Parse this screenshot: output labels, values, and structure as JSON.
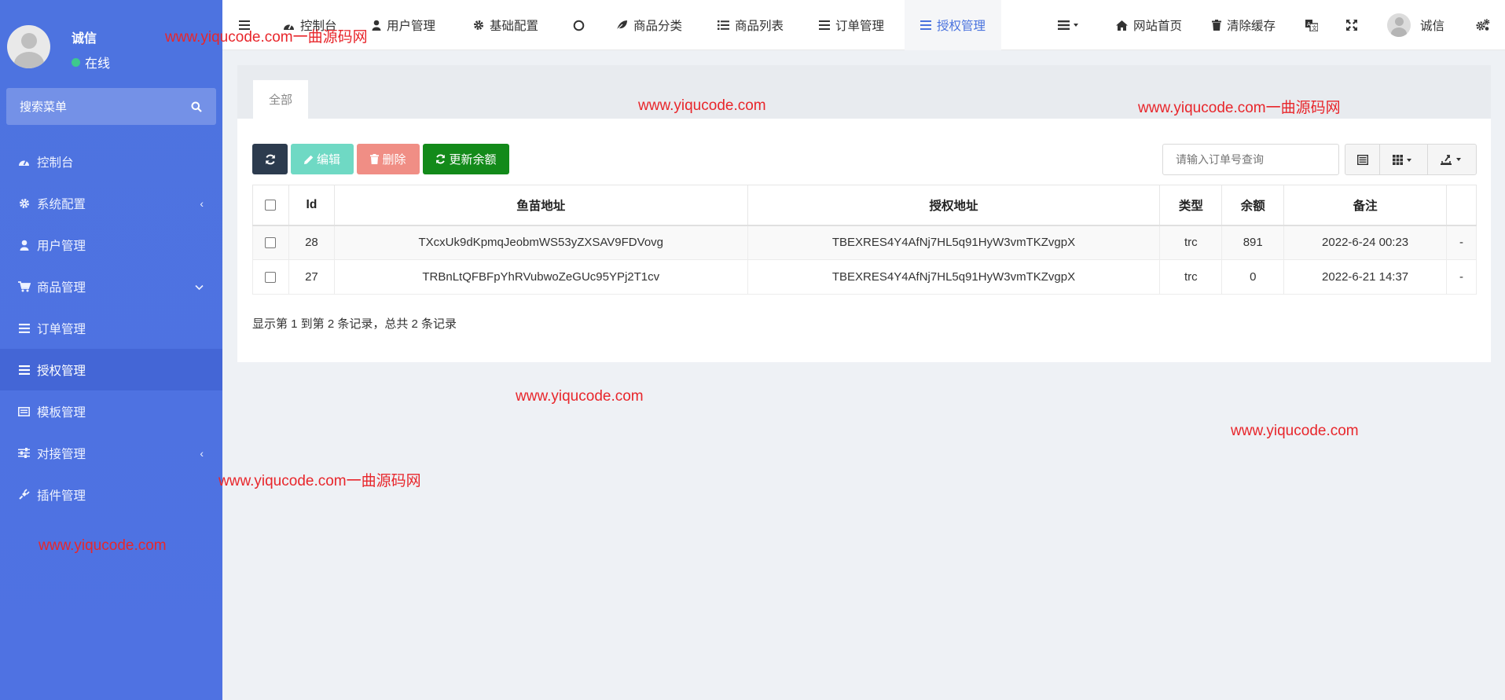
{
  "sidebar": {
    "user": {
      "name": "诚信",
      "status": "在线"
    },
    "search_label": "搜索菜单",
    "items": [
      {
        "label": "控制台",
        "icon": "dashboard-icon",
        "arrow": ""
      },
      {
        "label": "系统配置",
        "icon": "gear-icon",
        "arrow": "‹"
      },
      {
        "label": "用户管理",
        "icon": "user-icon",
        "arrow": ""
      },
      {
        "label": "商品管理",
        "icon": "cart-icon",
        "arrow": "⌄"
      },
      {
        "label": "订单管理",
        "icon": "list-icon",
        "arrow": ""
      },
      {
        "label": "授权管理",
        "icon": "list-icon",
        "arrow": "",
        "active": true
      },
      {
        "label": "模板管理",
        "icon": "template-icon",
        "arrow": ""
      },
      {
        "label": "对接管理",
        "icon": "sliders-icon",
        "arrow": "‹"
      },
      {
        "label": "插件管理",
        "icon": "plug-icon",
        "arrow": ""
      }
    ]
  },
  "topbar": {
    "nav": [
      {
        "label": "控制台",
        "icon": "dashboard-icon"
      },
      {
        "label": "用户管理",
        "icon": "user-icon"
      },
      {
        "label": "基础配置",
        "icon": "gear-icon"
      },
      {
        "label": "",
        "icon": "circle-icon"
      },
      {
        "label": "商品分类",
        "icon": "leaf-icon"
      },
      {
        "label": "商品列表",
        "icon": "list-ul-icon"
      },
      {
        "label": "订单管理",
        "icon": "list-icon"
      },
      {
        "label": "授权管理",
        "icon": "list-icon",
        "active": true
      }
    ],
    "right": {
      "home_label": "网站首页",
      "clear_cache_label": "清除缓存",
      "user_name": "诚信"
    }
  },
  "content": {
    "tab_all": "全部",
    "buttons": {
      "edit": "编辑",
      "delete": "删除",
      "update_balance": "更新余额"
    },
    "search_placeholder": "请输入订单号查询",
    "table": {
      "headers": [
        "Id",
        "鱼苗地址",
        "授权地址",
        "类型",
        "余额",
        "备注"
      ],
      "rows": [
        {
          "id": "28",
          "fish_address": "TXcxUk9dKpmqJeobmWS53yZXSAV9FDVovg",
          "auth_address": "TBEXRES4Y4AfNj7HL5q91HyW3vmTKZvgpX",
          "type": "trc",
          "balance": "891",
          "note": "2022-6-24 00:23",
          "extra": "-"
        },
        {
          "id": "27",
          "fish_address": "TRBnLtQFBFpYhRVubwoZeGUc95YPj2T1cv",
          "auth_address": "TBEXRES4Y4AfNj7HL5q91HyW3vmTKZvgpX",
          "type": "trc",
          "balance": "0",
          "note": "2022-6-21 14:37",
          "extra": "-"
        }
      ]
    },
    "pagination_info": "显示第 1 到第 2 条记录，总共 2 条记录"
  },
  "watermarks": {
    "w1": "www.yiqucode.com一曲源码网",
    "w2": "www.yiqucode.com",
    "w3": "www.yiqucode.com一曲源码网",
    "w4": "www.yiqucode.com",
    "w5": "www.yiqucode.com",
    "w6": "www.yiqucode.com一曲源码网",
    "w7": "www.yiqucode.com"
  },
  "colors": {
    "sidebar": "#4e73df",
    "accent": "#4a73de",
    "online": "#3ec98e",
    "btn_refresh": "#2c3b4e",
    "btn_edit": "#6fd9c4",
    "btn_delete": "#f08e85",
    "btn_update": "#138a1a",
    "watermark": "#e8262b"
  }
}
